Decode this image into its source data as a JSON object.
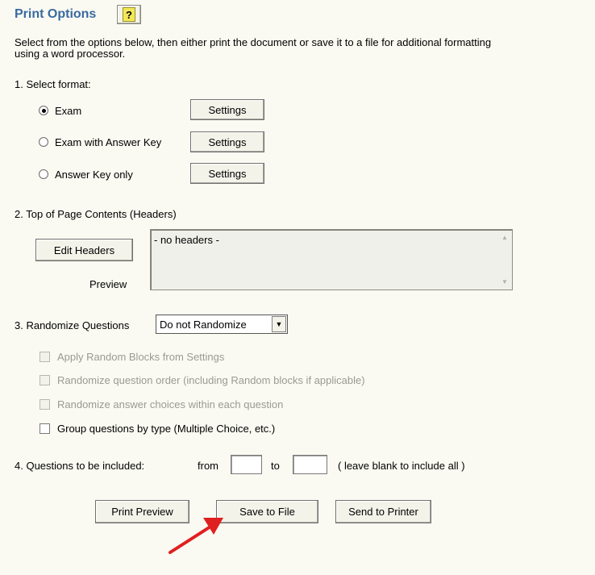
{
  "header": {
    "title": "Print Options",
    "help_label": "?"
  },
  "intro": "Select from the options below, then either print the document or save it to a file for additional formatting using a word processor.",
  "intro_line1": "Select from the options below, then either print the document or save it to a file for additional formatting",
  "intro_line2": "using a word processor.",
  "section1": {
    "label": "1.  Select format:",
    "options": [
      {
        "label": "Exam",
        "checked": true,
        "settings_label": "Settings"
      },
      {
        "label": "Exam with Answer Key",
        "checked": false,
        "settings_label": "Settings"
      },
      {
        "label": "Answer Key only",
        "checked": false,
        "settings_label": "Settings"
      }
    ]
  },
  "section2": {
    "label": "2.  Top of Page Contents (Headers)",
    "edit_button": "Edit Headers",
    "preview_label": "Preview",
    "preview_text": "- no headers -"
  },
  "section3": {
    "label": "3.  Randomize Questions",
    "select_value": "Do not Randomize",
    "checkboxes": [
      {
        "label": "Apply Random Blocks from Settings",
        "disabled": true,
        "checked": false
      },
      {
        "label": "Randomize question order (including Random blocks if applicable)",
        "disabled": true,
        "checked": false
      },
      {
        "label": "Randomize answer choices within each question",
        "disabled": true,
        "checked": false
      },
      {
        "label": "Group questions by type (Multiple Choice, etc.)",
        "disabled": false,
        "checked": false
      }
    ]
  },
  "section4": {
    "label": "4.  Questions to be included:",
    "from_label": "from",
    "to_label": "to",
    "hint": "( leave blank to include all )",
    "from_value": "",
    "to_value": ""
  },
  "actions": {
    "print_preview": "Print Preview",
    "save_to_file": "Save to File",
    "send_to_printer": "Send to Printer"
  },
  "colors": {
    "title": "#3a6aa0",
    "background": "#fafaf2",
    "arrow": "#e02020"
  }
}
